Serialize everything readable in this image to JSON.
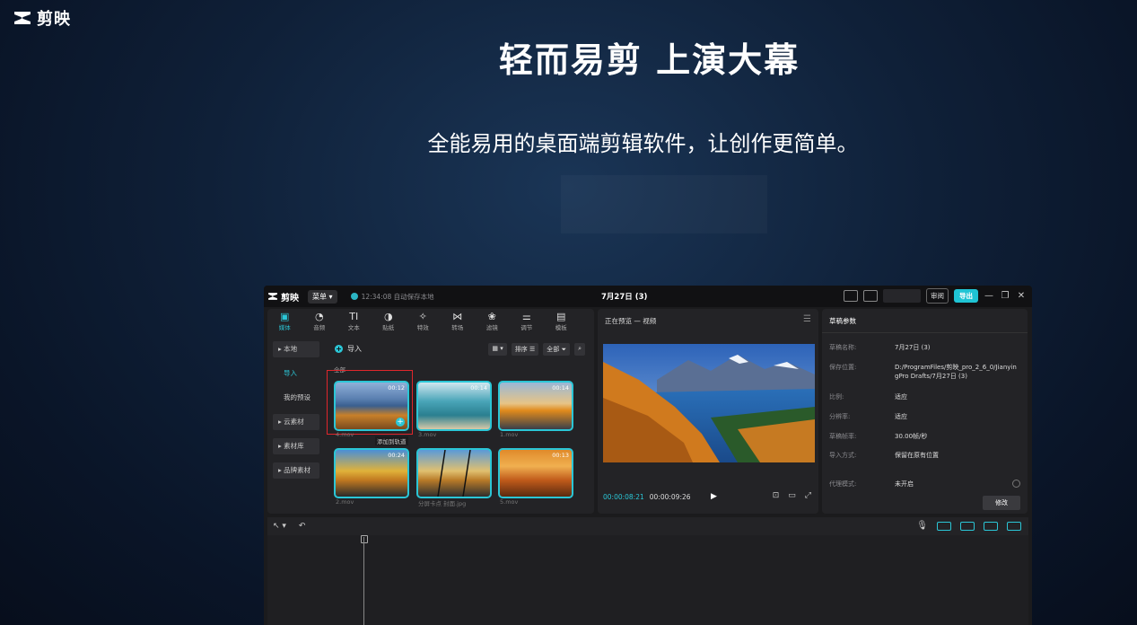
{
  "brand": {
    "name": "剪映"
  },
  "hero": {
    "title": "轻而易剪 上演大幕",
    "subtitle": "全能易用的桌面端剪辑软件，让创作更简单。"
  },
  "app": {
    "titlebar": {
      "app_name": "剪映",
      "menu_label": "菜单",
      "autosave": "12:34:08 自动保存本地",
      "project_title": "7月27日 (3)",
      "review_label": "审阅",
      "export_label": "导出"
    },
    "toolbar": [
      {
        "icon": "media-icon",
        "label": "媒体"
      },
      {
        "icon": "audio-icon",
        "label": "音频"
      },
      {
        "icon": "text-icon",
        "label": "文本"
      },
      {
        "icon": "sticker-icon",
        "label": "贴纸"
      },
      {
        "icon": "effects-icon",
        "label": "特效"
      },
      {
        "icon": "transition-icon",
        "label": "转场"
      },
      {
        "icon": "filter-icon",
        "label": "滤镜"
      },
      {
        "icon": "adjust-icon",
        "label": "调节"
      },
      {
        "icon": "template-icon",
        "label": "模板"
      }
    ],
    "sidebar": {
      "local": "本地",
      "import": "导入",
      "presets": "我的预设",
      "cloud": "云素材",
      "library": "素材库",
      "brand": "品牌素材"
    },
    "media": {
      "import_label": "导入",
      "sort_label": "排序",
      "filter_label": "全部",
      "all_label": "全部",
      "add_tip": "添加到轨道",
      "clips": [
        {
          "name": "4.mov",
          "duration": "00:12"
        },
        {
          "name": "3.mov",
          "duration": "00:14"
        },
        {
          "name": "1.mov",
          "duration": "00:14"
        },
        {
          "name": "2.mov",
          "duration": "00:24"
        },
        {
          "name": "分屏卡点 封面.jpg",
          "duration": ""
        },
        {
          "name": "5.mov",
          "duration": "00:13"
        }
      ]
    },
    "preview": {
      "title": "正在预览 — 视频",
      "current_time": "00:00:08:21",
      "total_time": "00:00:09:26"
    },
    "draft": {
      "title": "草稿参数",
      "rows": [
        {
          "key": "草稿名称:",
          "value": "7月27日 (3)"
        },
        {
          "key": "保存位置:",
          "value": "D:/ProgramFiles/剪映_pro_2_6_0/JianyingPro Drafts/7月27日 (3)"
        },
        {
          "key": "比例:",
          "value": "适应"
        },
        {
          "key": "分辨率:",
          "value": "适应"
        },
        {
          "key": "草稿帧率:",
          "value": "30.00帧/秒"
        },
        {
          "key": "导入方式:",
          "value": "保留在原有位置"
        },
        {
          "key": "代理模式:",
          "value": "未开启"
        }
      ],
      "modify_label": "修改"
    }
  },
  "colors": {
    "accent": "#2bc6d6",
    "selection": "#e0262c"
  }
}
